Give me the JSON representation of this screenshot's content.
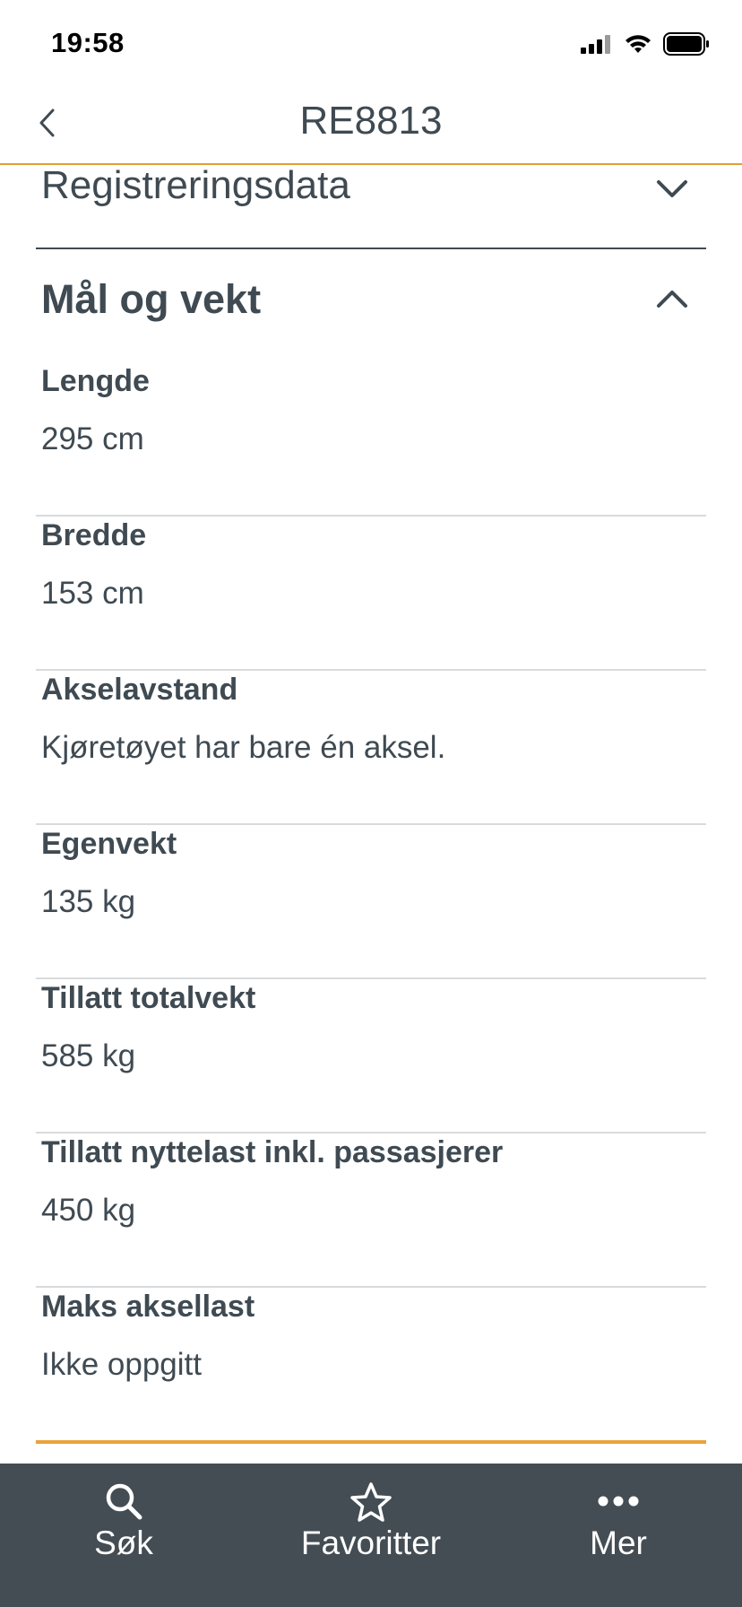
{
  "status_bar": {
    "time": "19:58"
  },
  "nav": {
    "title": "RE8813"
  },
  "sections": {
    "collapsed": {
      "title": "Registreringsdata"
    },
    "open": {
      "title": "Mål og vekt"
    }
  },
  "items": [
    {
      "label": "Lengde",
      "value": "295 cm"
    },
    {
      "label": "Bredde",
      "value": "153 cm"
    },
    {
      "label": "Akselavstand",
      "value": "Kjøretøyet har bare én aksel."
    },
    {
      "label": "Egenvekt",
      "value": "135 kg"
    },
    {
      "label": "Tillatt totalvekt",
      "value": "585 kg"
    },
    {
      "label": "Tillatt nyttelast inkl. passasjerer",
      "value": "450 kg"
    },
    {
      "label": "Maks aksellast",
      "value": "Ikke oppgitt"
    }
  ],
  "tabs": [
    {
      "label": "Søk",
      "icon": "search-icon"
    },
    {
      "label": "Favoritter",
      "icon": "star-icon"
    },
    {
      "label": "Mer",
      "icon": "more-icon"
    }
  ],
  "colors": {
    "accent": "#e0a030",
    "text": "#3f4a52",
    "tab_bar": "#444d54"
  }
}
